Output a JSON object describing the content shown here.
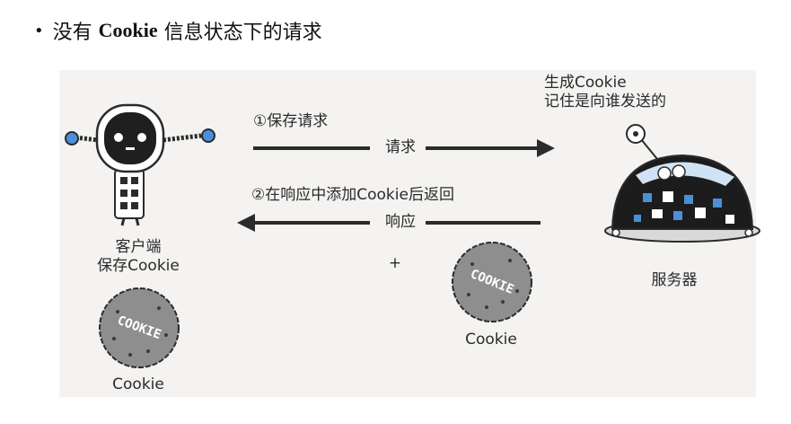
{
  "heading": {
    "bullet": "•",
    "pre": "没有",
    "keyword": "Cookie",
    "post": "信息状态下的请求"
  },
  "diagram": {
    "step1": "①保存请求",
    "request_label": "请求",
    "step2": "②在响应中添加Cookie后返回",
    "response_label": "响应",
    "server_note_line1": "生成Cookie",
    "server_note_line2": "记住是向谁发送的",
    "client_label_line1": "客户端",
    "client_label_line2": "保存Cookie",
    "server_label": "服务器",
    "plus": "+",
    "cookie_caption_right": "Cookie",
    "cookie_caption_left": "Cookie",
    "cookie_text": "COOKIE"
  },
  "colors": {
    "arrow": "#2b2b2b",
    "panel": "#f4f3f1",
    "server_dark": "#1c1c1c",
    "accent_blue": "#4a90d9",
    "cookie_gray": "#8e8e8e"
  },
  "icons": [
    "client-robot-icon",
    "server-robot-icon",
    "cookie-icon"
  ]
}
